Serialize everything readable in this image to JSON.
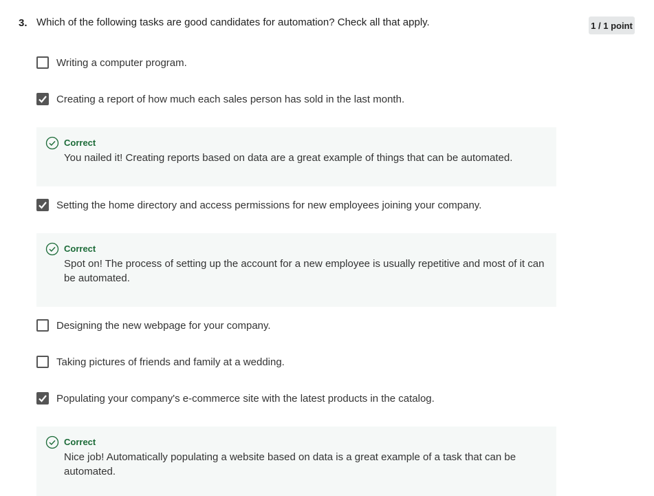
{
  "question": {
    "number": "3.",
    "text": "Which of the following tasks are good candidates for automation? Check all that apply.",
    "score": "1 / 1 point"
  },
  "options": [
    {
      "label": "Writing a computer program.",
      "checked": false
    },
    {
      "label": "Creating a report of how much each sales person has sold in the last month.",
      "checked": true
    },
    {
      "label": "Setting the home directory and access permissions for new employees joining your company.",
      "checked": true
    },
    {
      "label": "Designing the new webpage for your company.",
      "checked": false
    },
    {
      "label": "Taking pictures of friends and family at a wedding.",
      "checked": false
    },
    {
      "label": "Populating your company's e-commerce site with the latest products in the catalog.",
      "checked": true
    }
  ],
  "feedback": [
    {
      "title": "Correct",
      "text": "You nailed it! Creating reports based on data are a great example of things that can be automated."
    },
    {
      "title": "Correct",
      "text": "Spot on! The process of setting up the account for a new employee is usually repetitive and most of it can be automated."
    },
    {
      "title": "Correct",
      "text": "Nice job! Automatically populating a website based on data is a great example of a task that can be automated."
    }
  ],
  "colors": {
    "correct_green": "#1c6b38",
    "feedback_bg": "#f5f8f7",
    "checkbox": "#555555"
  },
  "icons": {
    "check": "checkmark-icon",
    "correct": "check-circle-icon"
  }
}
